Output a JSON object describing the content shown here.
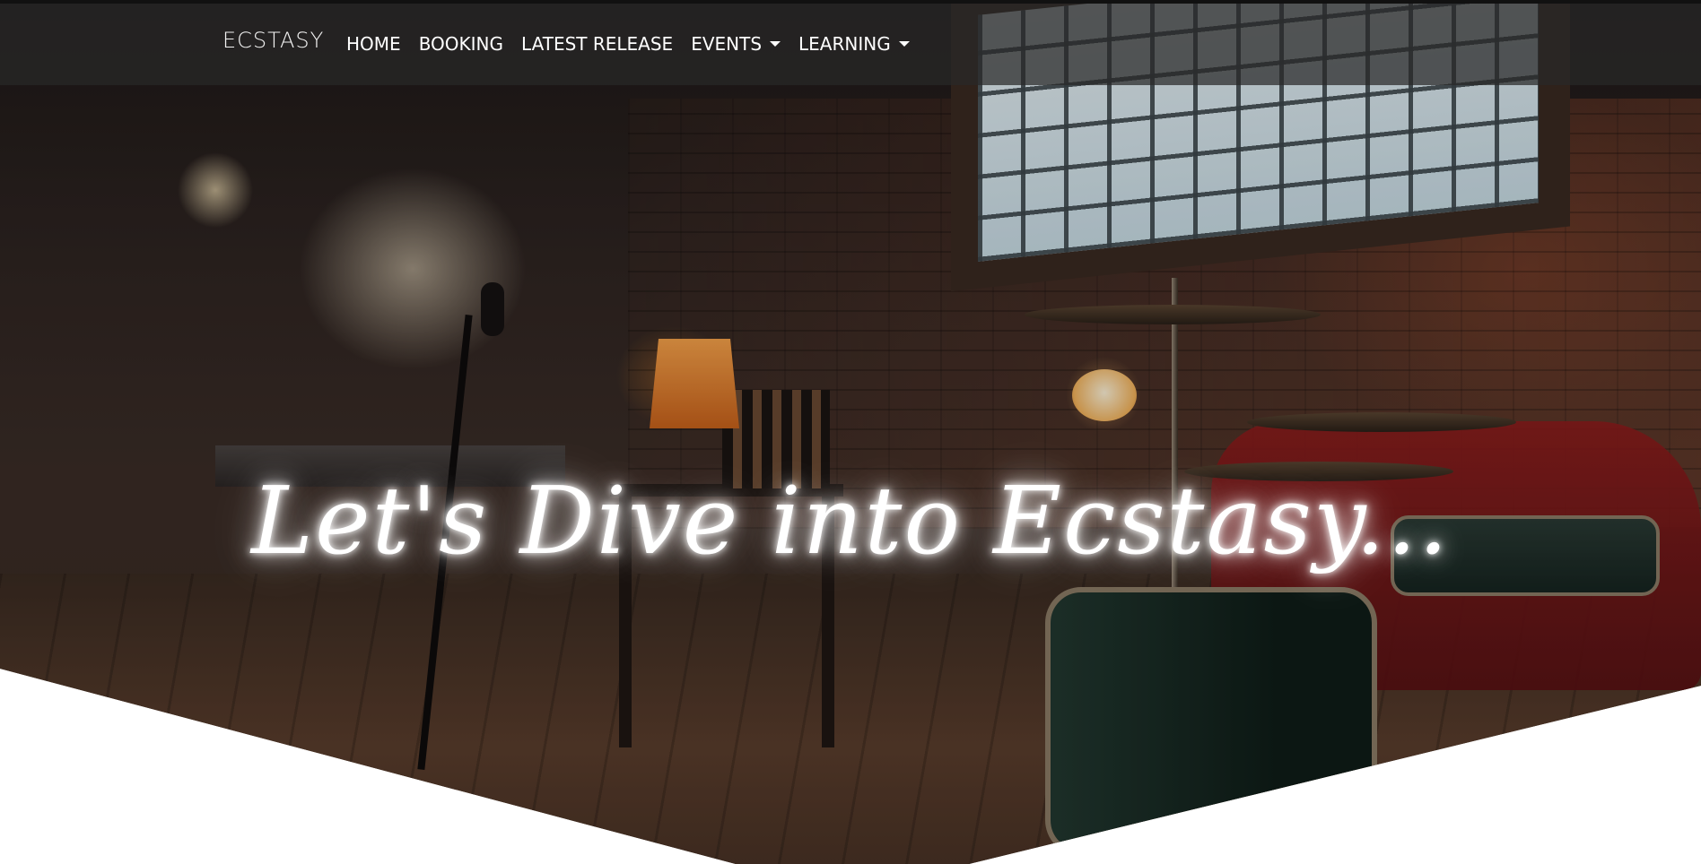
{
  "navbar": {
    "brand": "ECSTASY",
    "items": [
      {
        "label": "HOME",
        "dropdown": false
      },
      {
        "label": "BOOKING",
        "dropdown": false
      },
      {
        "label": "LATEST RELEASE",
        "dropdown": false
      },
      {
        "label": "EVENTS",
        "dropdown": true
      },
      {
        "label": "LEARNING",
        "dropdown": true
      }
    ]
  },
  "hero": {
    "title": "Let's Dive into Ecstasy...",
    "background_image": "music studio with microphone, lamp, drum kit and brick wall",
    "colors": {
      "title_glow": "#ffffff",
      "navbar_bg": "#282828"
    }
  }
}
